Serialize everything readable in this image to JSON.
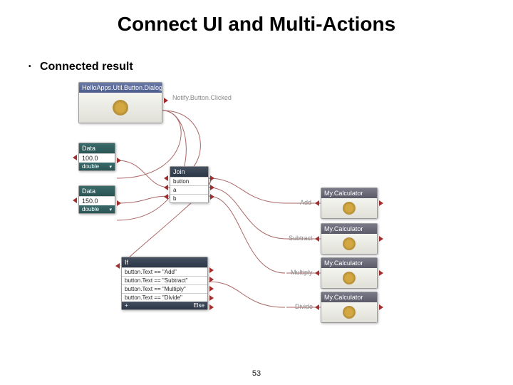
{
  "title": "Connect UI and Multi-Actions",
  "subtitle": "Connected result",
  "page_number": "53",
  "nodes": {
    "dialog": {
      "header": "HelloApps.Util.Button.Dialog"
    },
    "notify_label": "Notify.Button.Clicked",
    "data1": {
      "header": "Data",
      "value": "100.0",
      "type": "double"
    },
    "data2": {
      "header": "Data",
      "value": "150.0",
      "type": "double"
    },
    "join": {
      "header": "Join",
      "rows": [
        "button",
        "a",
        "b"
      ]
    },
    "if": {
      "header": "If",
      "rows": [
        "button.Text == \"Add\"",
        "button.Text == \"Subtract\"",
        "button.Text == \"Multiply\"",
        "button.Text == \"Divide\""
      ],
      "footer_left": "+",
      "footer_right": "Else"
    },
    "calc": {
      "header": "My.Calculator"
    },
    "op_labels": [
      "Add",
      "Subtract",
      "Multiply",
      "Divide"
    ]
  }
}
